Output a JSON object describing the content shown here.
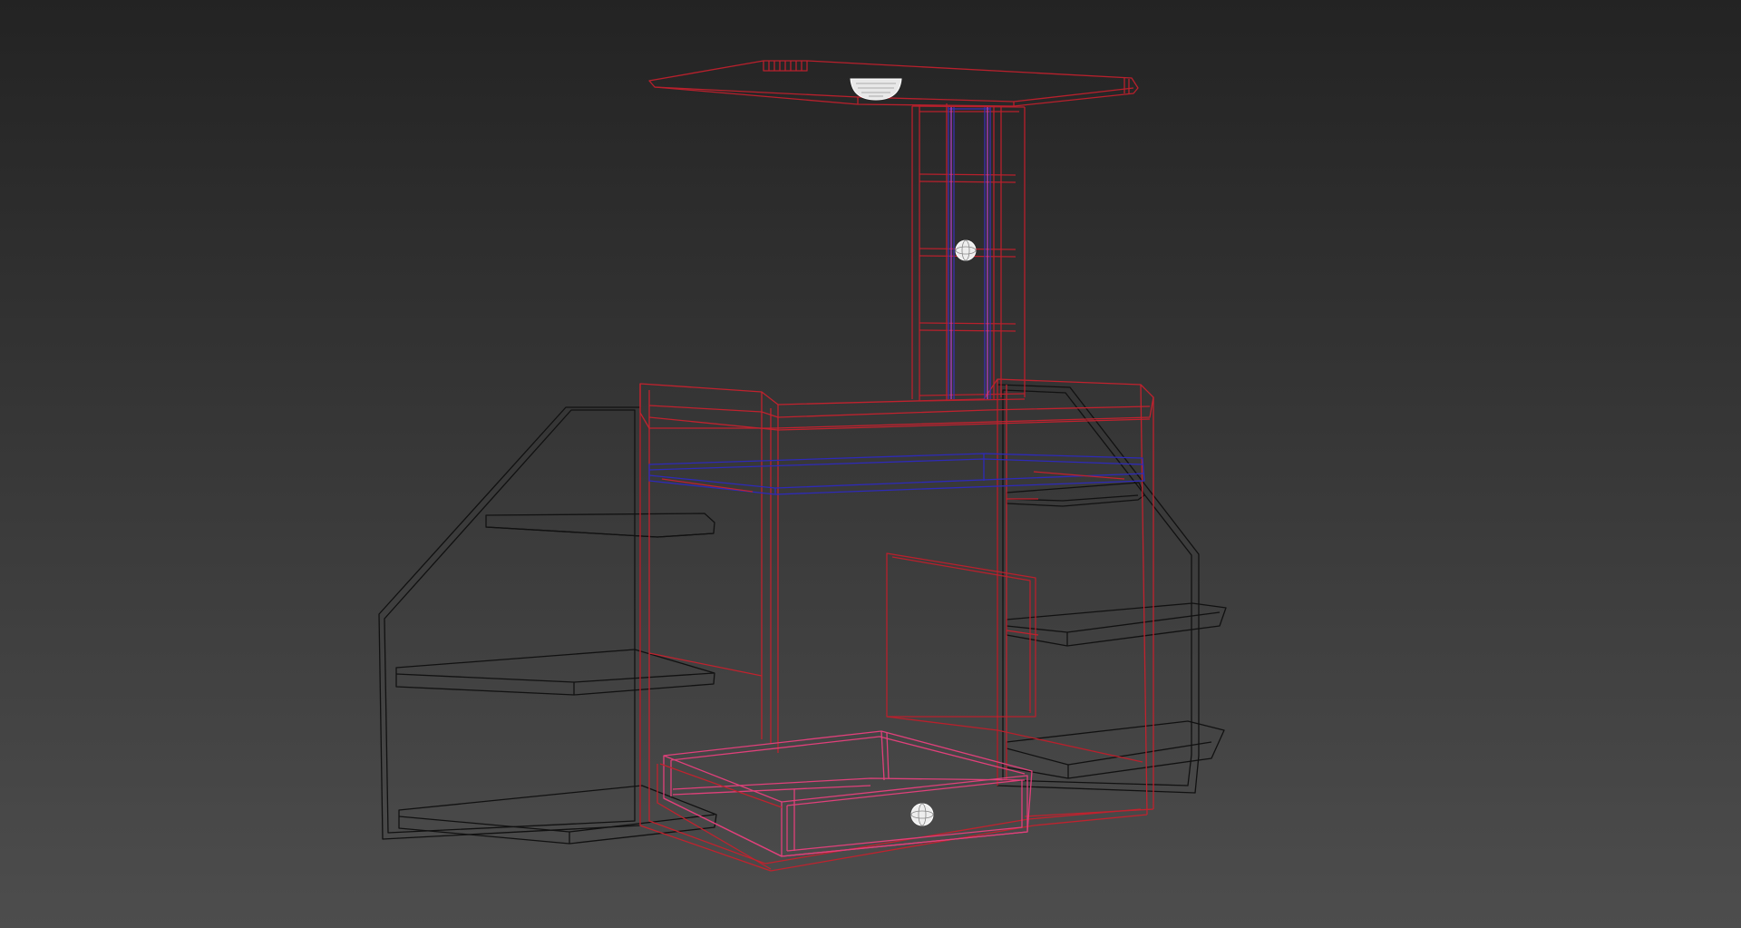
{
  "viewport": {
    "background_top": "#232323",
    "background_bottom": "#4d4d4d"
  },
  "scene": {
    "objects": [
      {
        "name": "canopy-panel",
        "wire_color": "#b8202c",
        "selected": true
      },
      {
        "name": "center-column",
        "wire_color": "#b8202c",
        "selected": true
      },
      {
        "name": "column-inner-frame",
        "wire_color": "#3a2fb0",
        "selected": true
      },
      {
        "name": "desk-body",
        "wire_color": "#c0222e",
        "selected": true
      },
      {
        "name": "desk-top-shelf",
        "wire_color": "#2e2ab8",
        "selected": true
      },
      {
        "name": "left-shelf-unit",
        "wire_color": "#111111",
        "selected": false
      },
      {
        "name": "right-shelf-unit",
        "wire_color": "#111111",
        "selected": false
      },
      {
        "name": "back-panel",
        "wire_color": "#b8202c",
        "selected": true
      },
      {
        "name": "drawer",
        "wire_color": "#e0407a",
        "selected": true
      }
    ],
    "lights": [
      {
        "name": "canopy-light",
        "type": "dome"
      },
      {
        "name": "column-light",
        "type": "sphere"
      },
      {
        "name": "drawer-light",
        "type": "sphere"
      }
    ]
  }
}
